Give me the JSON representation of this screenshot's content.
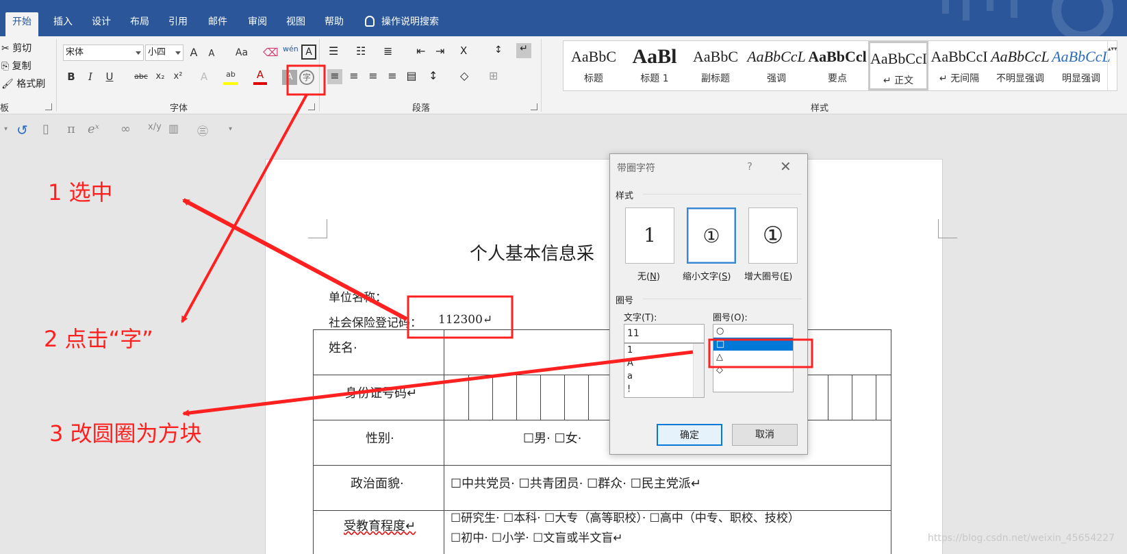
{
  "ribbon_tabs": [
    "开始",
    "插入",
    "设计",
    "布局",
    "引用",
    "邮件",
    "审阅",
    "视图",
    "帮助"
  ],
  "tell_me": "操作说明搜索",
  "clipboard": {
    "cut": "剪切",
    "copy": "复制",
    "format_painter": "格式刷",
    "group_label": "板"
  },
  "font": {
    "name": "宋体",
    "size": "小四",
    "group_label": "字体",
    "change_case": "Aa",
    "grow": "A",
    "shrink": "A"
  },
  "paragraph": {
    "group_label": "段落"
  },
  "styles": {
    "group_label": "样式",
    "items": [
      {
        "preview": "AaBbC",
        "name": "标题"
      },
      {
        "preview": "AaBl",
        "name": "标题 1"
      },
      {
        "preview": "AaBbC",
        "name": "副标题"
      },
      {
        "preview": "AaBbCcL",
        "name": "强调"
      },
      {
        "preview": "AaBbCcl",
        "name": "要点"
      },
      {
        "preview": "AaBbCcI",
        "name": "↵ 正文"
      },
      {
        "preview": "AaBbCcI",
        "name": "↵ 无间隔"
      },
      {
        "preview": "AaBbCcL",
        "name": "不明显强调"
      },
      {
        "preview": "AaBbCcL",
        "name": "明显强调"
      }
    ]
  },
  "document": {
    "title": "个人基本信息采",
    "unit_label": "单位名称：",
    "ss_label": "社会保险登记码：",
    "ss_value": "112300↵",
    "rows": {
      "name": "姓名·",
      "id": "身份证号码↵",
      "gender": "性别·",
      "gender_options": "☐男· ☐女·",
      "politics": "政治面貌·",
      "politics_options": "☐中共党员·  ☐共青团员· ☐群众·  ☐民主党派↵",
      "education": "受教育程度↵",
      "education_line1": "☐研究生· ☐本科· ☐大专（高等职校）· ☐高中（中专、职校、技校）",
      "education_line2": "☐初中· ☐小学· ☐文盲或半文盲↵"
    }
  },
  "dialog": {
    "title": "带圈字符",
    "help": "?",
    "close": "✕",
    "style_section": "样式",
    "styles": [
      {
        "char": "1",
        "label_main": "无(",
        "label_key": "N",
        "label_end": ")"
      },
      {
        "char": "①",
        "label_main": "缩小文字(",
        "label_key": "S",
        "label_end": ")"
      },
      {
        "char": "①",
        "label_main": "增大圈号(",
        "label_key": "E",
        "label_end": ")"
      }
    ],
    "enclosure_section": "圈号",
    "text_label": "文字(T):",
    "enclosure_label": "圈号(O):",
    "text_value": "11",
    "text_list": [
      "1",
      "A",
      "a",
      "!"
    ],
    "enclosure_list": [
      "○",
      "□",
      "△",
      "◇"
    ],
    "ok": "确定",
    "cancel": "取消"
  },
  "annotations": [
    "1  选中",
    "2  点击“字”",
    "3  改圆圈为方块"
  ],
  "annotation_color": "#ff2020",
  "accent_color": "#2b579a",
  "watermark": "https://blog.csdn.net/weixin_45654227"
}
